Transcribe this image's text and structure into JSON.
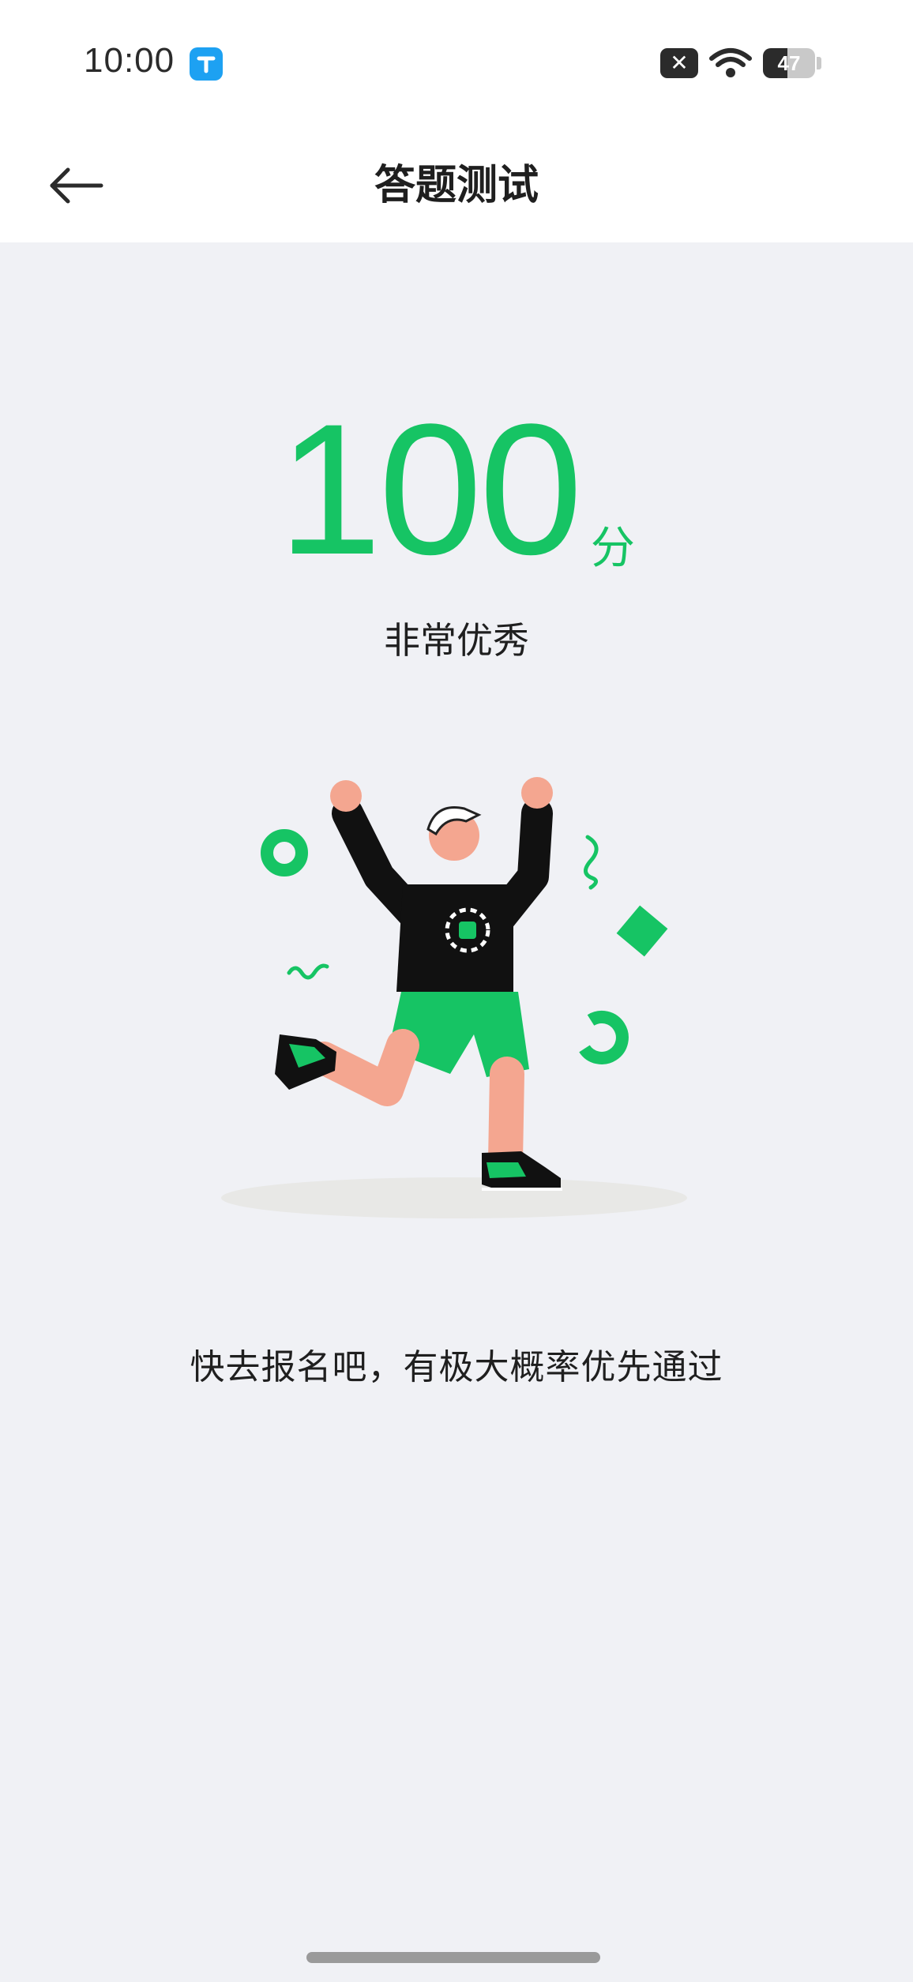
{
  "status_bar": {
    "time": "10:00",
    "battery": "47",
    "icons": [
      "app-icon",
      "no-sim-icon",
      "wifi-icon",
      "battery-icon"
    ]
  },
  "nav": {
    "title": "答题测试",
    "back_icon": "arrow-left-icon"
  },
  "result": {
    "score": "100",
    "unit": "分",
    "rating": "非常优秀",
    "message": "快去报名吧，有极大概率优先通过"
  },
  "colors": {
    "accent": "#16c464",
    "background": "#f0f1f5",
    "text": "#1f1f1f"
  }
}
